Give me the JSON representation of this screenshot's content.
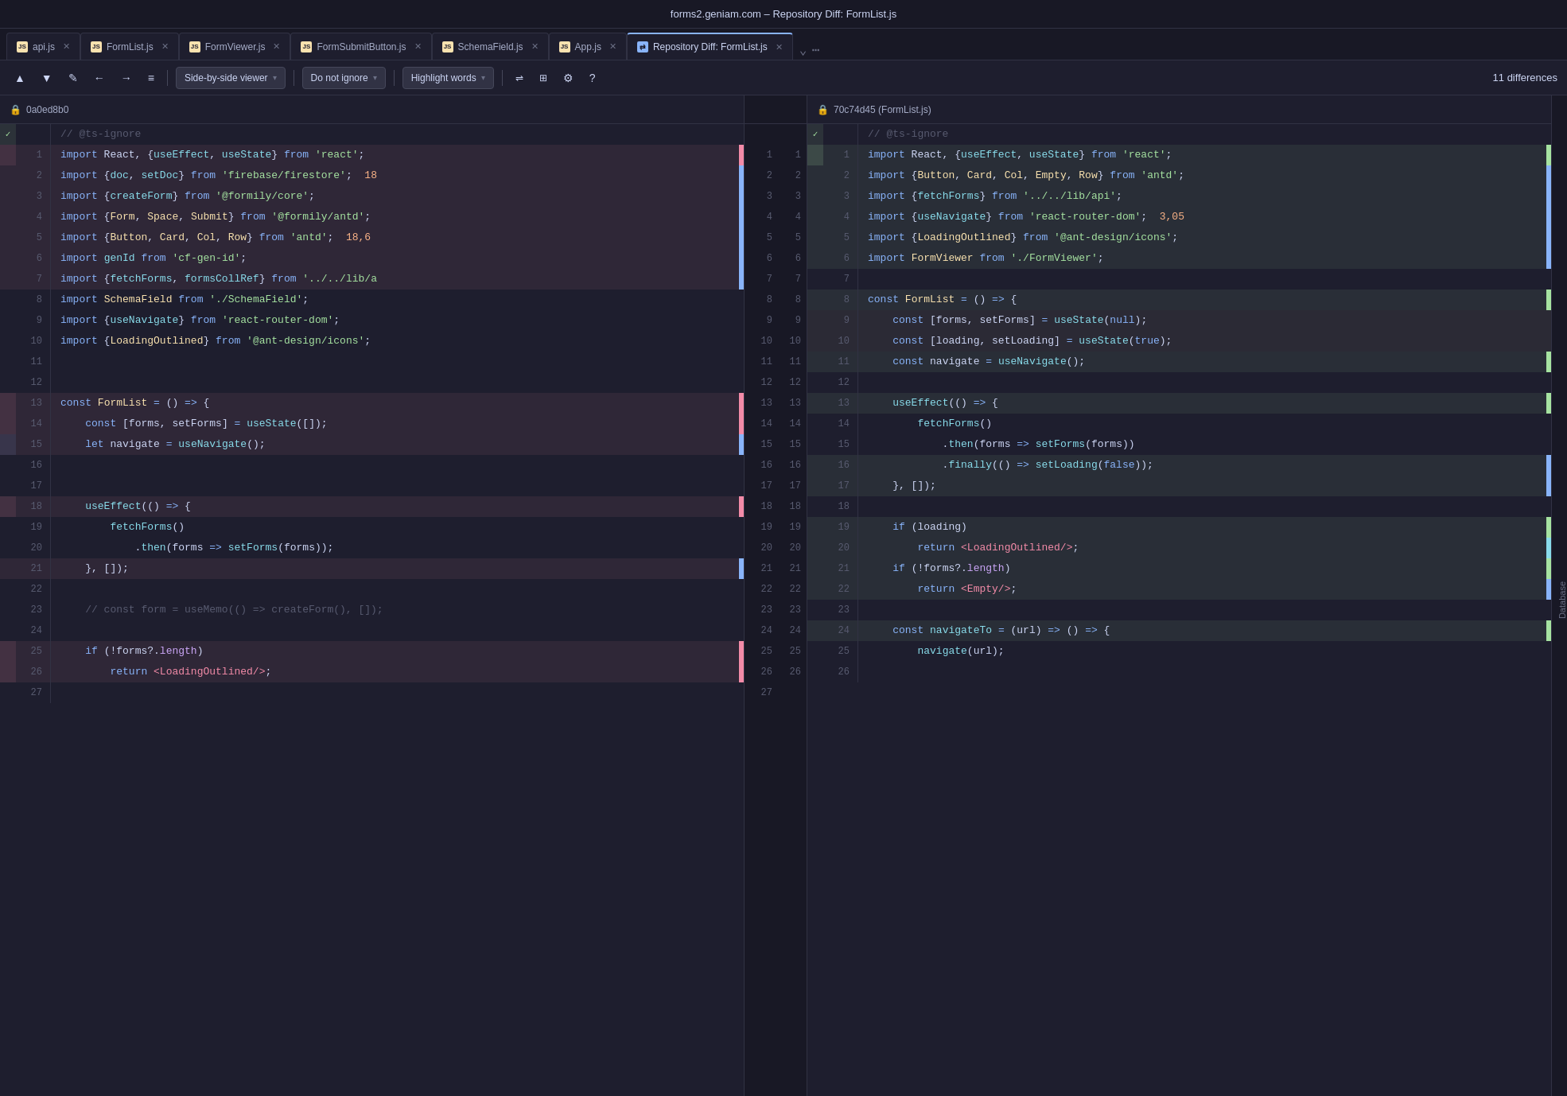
{
  "titleBar": {
    "title": "forms2.geniam.com – Repository Diff: FormList.js"
  },
  "tabs": [
    {
      "id": "api",
      "label": "api.js",
      "iconType": "js",
      "active": false
    },
    {
      "id": "formlist",
      "label": "FormList.js",
      "iconType": "js",
      "active": false
    },
    {
      "id": "formviewer",
      "label": "FormViewer.js",
      "iconType": "js",
      "active": false
    },
    {
      "id": "formsubmit",
      "label": "FormSubmitButton.js",
      "iconType": "js",
      "active": false
    },
    {
      "id": "schemafield",
      "label": "SchemaField.js",
      "iconType": "js",
      "active": false
    },
    {
      "id": "appjs",
      "label": "App.js",
      "iconType": "js",
      "active": false
    },
    {
      "id": "repodiff",
      "label": "Repository Diff: FormList.js",
      "iconType": "diff",
      "active": true
    }
  ],
  "toolbar": {
    "upBtn": "▲",
    "downBtn": "▼",
    "editBtn": "✎",
    "backBtn": "←",
    "fwdBtn": "→",
    "listBtn": "≡",
    "viewerLabel": "Side-by-side viewer",
    "ignoreLabel": "Do not ignore",
    "highlightLabel": "Highlight words",
    "settingsBtn": "⚙",
    "helpBtn": "?",
    "diffCount": "11 differences"
  },
  "leftPane": {
    "hash": "0a0ed8b0"
  },
  "rightPane": {
    "hash": "70c74d45 (FormList.js)"
  },
  "leftLines": [
    {
      "lineNum": "",
      "marker": "✓",
      "markerClass": "marker-added",
      "bg": "",
      "content": "// @ts-ignore",
      "contentClass": "cm"
    },
    {
      "lineNum": "1",
      "marker": "",
      "markerClass": "",
      "bg": "bg-removed",
      "ind": "ind-red",
      "content": "import React, {useEffect, useState} from 'react';"
    },
    {
      "lineNum": "2",
      "marker": "",
      "markerClass": "",
      "bg": "bg-removed",
      "ind": "ind-blue",
      "content": "import {doc, setDoc} from 'firebase/firestore';  18"
    },
    {
      "lineNum": "3",
      "marker": "",
      "markerClass": "",
      "bg": "bg-removed",
      "ind": "ind-blue",
      "content": "import {createForm} from '@formily/core';"
    },
    {
      "lineNum": "4",
      "marker": "",
      "markerClass": "",
      "bg": "bg-removed",
      "ind": "ind-blue",
      "content": "import {Form, Space, Submit} from '@formily/antd';"
    },
    {
      "lineNum": "5",
      "marker": "",
      "markerClass": "",
      "bg": "bg-removed",
      "ind": "ind-blue",
      "content": "import {Button, Card, Col, Row} from 'antd';  18,6"
    },
    {
      "lineNum": "6",
      "marker": "",
      "markerClass": "",
      "bg": "bg-removed",
      "ind": "ind-blue",
      "content": "import genId from 'cf-gen-id';"
    },
    {
      "lineNum": "7",
      "marker": "",
      "markerClass": "",
      "bg": "bg-removed",
      "ind": "ind-blue",
      "content": "import {fetchForms, formsCollRef} from '../../lib/a"
    },
    {
      "lineNum": "8",
      "marker": "",
      "markerClass": "",
      "bg": "",
      "content": "import SchemaField from './SchemaField';"
    },
    {
      "lineNum": "9",
      "marker": "",
      "markerClass": "",
      "bg": "",
      "content": "import {useNavigate} from 'react-router-dom';"
    },
    {
      "lineNum": "10",
      "marker": "",
      "markerClass": "",
      "bg": "",
      "content": "import {LoadingOutlined} from '@ant-design/icons';"
    },
    {
      "lineNum": "11",
      "marker": "",
      "markerClass": "",
      "bg": "",
      "content": ""
    },
    {
      "lineNum": "12",
      "marker": "",
      "markerClass": "",
      "bg": "",
      "content": ""
    },
    {
      "lineNum": "13",
      "marker": "",
      "markerClass": "",
      "bg": "bg-removed",
      "ind": "ind-red",
      "content": "const FormList = () => {"
    },
    {
      "lineNum": "14",
      "marker": "",
      "markerClass": "",
      "bg": "bg-removed",
      "ind": "ind-red",
      "content": "    const [forms, setForms] = useState([]);"
    },
    {
      "lineNum": "15",
      "marker": "",
      "markerClass": "",
      "bg": "bg-removed",
      "ind": "ind-red",
      "content": "    let navigate = useNavigate();"
    },
    {
      "lineNum": "16",
      "marker": "",
      "markerClass": "",
      "bg": "",
      "content": ""
    },
    {
      "lineNum": "17",
      "marker": "",
      "markerClass": "",
      "bg": "",
      "content": ""
    },
    {
      "lineNum": "18",
      "marker": "",
      "markerClass": "",
      "bg": "bg-removed",
      "ind": "ind-red",
      "content": "    useEffect(() => {"
    },
    {
      "lineNum": "19",
      "marker": "",
      "markerClass": "",
      "bg": "",
      "content": "        fetchForms()"
    },
    {
      "lineNum": "20",
      "marker": "",
      "markerClass": "",
      "bg": "",
      "content": "            .then(forms => setForms(forms));"
    },
    {
      "lineNum": "21",
      "marker": "",
      "markerClass": "",
      "bg": "bg-removed",
      "ind": "ind-blue",
      "content": "    }, []);"
    },
    {
      "lineNum": "22",
      "marker": "",
      "markerClass": "",
      "bg": "",
      "content": ""
    },
    {
      "lineNum": "23",
      "marker": "",
      "markerClass": "",
      "bg": "",
      "content": "    // const form = useMemo(() => createForm(), []);"
    },
    {
      "lineNum": "24",
      "marker": "",
      "markerClass": "",
      "bg": "",
      "content": ""
    },
    {
      "lineNum": "25",
      "marker": "",
      "markerClass": "",
      "bg": "bg-removed",
      "ind": "ind-red",
      "content": "    if (!forms?.length)"
    },
    {
      "lineNum": "26",
      "marker": "",
      "markerClass": "",
      "bg": "bg-removed",
      "ind": "ind-red",
      "content": "        return <LoadingOutlined/>;"
    },
    {
      "lineNum": "27",
      "marker": "",
      "markerClass": "",
      "bg": "",
      "content": ""
    }
  ],
  "rightLines": [
    {
      "lineNum": "",
      "marker": "✓",
      "markerClass": "marker-added",
      "bg": "",
      "content": "// @ts-ignore",
      "contentClass": "cm"
    },
    {
      "lineNum": "1",
      "marker": "",
      "markerClass": "",
      "bg": "bg-added",
      "ind": "ind-green",
      "content": "import React, {useEffect, useState} from 'react';"
    },
    {
      "lineNum": "2",
      "marker": "",
      "markerClass": "",
      "bg": "bg-added",
      "ind": "ind-blue",
      "content": "import {Button, Card, Col, Empty, Row} from 'antd';"
    },
    {
      "lineNum": "3",
      "marker": "",
      "markerClass": "",
      "bg": "bg-added",
      "ind": "ind-blue",
      "content": "import {fetchForms} from '../../lib/api';"
    },
    {
      "lineNum": "4",
      "marker": "",
      "markerClass": "",
      "bg": "bg-added",
      "ind": "ind-blue",
      "content": "import {useNavigate} from 'react-router-dom';  3,05"
    },
    {
      "lineNum": "5",
      "marker": "",
      "markerClass": "",
      "bg": "bg-added",
      "ind": "ind-blue",
      "content": "import {LoadingOutlined} from '@ant-design/icons';"
    },
    {
      "lineNum": "6",
      "marker": "",
      "markerClass": "",
      "bg": "bg-added",
      "ind": "ind-blue",
      "content": "import FormViewer from './FormViewer';"
    },
    {
      "lineNum": "7",
      "marker": "",
      "markerClass": "",
      "bg": "",
      "content": ""
    },
    {
      "lineNum": "8",
      "marker": "",
      "markerClass": "",
      "bg": "bg-added",
      "ind": "ind-green",
      "content": "const FormList = () => {"
    },
    {
      "lineNum": "9",
      "marker": "",
      "markerClass": "",
      "bg": "bg-changed",
      "content": "    const [forms, setForms] = useState(null);"
    },
    {
      "lineNum": "10",
      "marker": "",
      "markerClass": "",
      "bg": "bg-changed",
      "content": "    const [loading, setLoading] = useState(true);"
    },
    {
      "lineNum": "11",
      "marker": "",
      "markerClass": "",
      "bg": "bg-added",
      "ind": "ind-green",
      "content": "    const navigate = useNavigate();"
    },
    {
      "lineNum": "12",
      "marker": "",
      "markerClass": "",
      "bg": "",
      "content": ""
    },
    {
      "lineNum": "13",
      "marker": "",
      "markerClass": "",
      "bg": "bg-added",
      "ind": "ind-green",
      "content": "    useEffect(() => {"
    },
    {
      "lineNum": "14",
      "marker": "",
      "markerClass": "",
      "bg": "",
      "content": "        fetchForms()"
    },
    {
      "lineNum": "15",
      "marker": "",
      "markerClass": "",
      "bg": "",
      "content": "            .then(forms => setForms(forms))"
    },
    {
      "lineNum": "16",
      "marker": "",
      "markerClass": "",
      "bg": "bg-added",
      "ind": "ind-blue",
      "content": "            .finally(() => setLoading(false));"
    },
    {
      "lineNum": "17",
      "marker": "",
      "markerClass": "",
      "bg": "bg-added",
      "ind": "ind-blue",
      "content": "    }, []);"
    },
    {
      "lineNum": "18",
      "marker": "",
      "markerClass": "",
      "bg": "",
      "content": ""
    },
    {
      "lineNum": "19",
      "marker": "",
      "markerClass": "",
      "bg": "bg-added",
      "ind": "ind-green",
      "content": "    if (loading)"
    },
    {
      "lineNum": "20",
      "marker": "",
      "markerClass": "",
      "bg": "bg-added",
      "ind": "ind-blue",
      "content": "        return <LoadingOutlined/>;"
    },
    {
      "lineNum": "21",
      "marker": "",
      "markerClass": "",
      "bg": "bg-added",
      "ind": "ind-green",
      "content": "    if (!forms?.length)"
    },
    {
      "lineNum": "22",
      "marker": "",
      "markerClass": "",
      "bg": "bg-added",
      "ind": "ind-blue",
      "content": "        return <Empty/>;"
    },
    {
      "lineNum": "23",
      "marker": "",
      "markerClass": "",
      "bg": "",
      "content": ""
    },
    {
      "lineNum": "24",
      "marker": "",
      "markerClass": "",
      "bg": "bg-added",
      "ind": "ind-green",
      "content": "    const navigateTo = (url) => () => {"
    },
    {
      "lineNum": "25",
      "marker": "",
      "markerClass": "",
      "bg": "",
      "content": "        navigate(url);"
    },
    {
      "lineNum": "26",
      "marker": "",
      "markerClass": "",
      "bg": "",
      "content": ""
    }
  ],
  "centerLineNums": [
    [
      "",
      ""
    ],
    [
      "1",
      "1"
    ],
    [
      "2",
      "2"
    ],
    [
      "3",
      "3"
    ],
    [
      "4",
      "4"
    ],
    [
      "5",
      "5"
    ],
    [
      "6",
      "6"
    ],
    [
      "7",
      "7"
    ],
    [
      "8",
      "8"
    ],
    [
      "9",
      "9"
    ],
    [
      "10",
      "10"
    ],
    [
      "11",
      "11"
    ],
    [
      "12",
      "12"
    ],
    [
      "13",
      "13"
    ],
    [
      "14",
      "14"
    ],
    [
      "15",
      "15"
    ],
    [
      "16",
      "16"
    ],
    [
      "17",
      "17"
    ],
    [
      "18",
      "18"
    ],
    [
      "19",
      "19"
    ],
    [
      "20",
      "20"
    ],
    [
      "21",
      "21"
    ],
    [
      "22",
      "22"
    ],
    [
      "23",
      "23"
    ],
    [
      "24",
      "24"
    ],
    [
      "25",
      "25"
    ],
    [
      "26",
      "26"
    ],
    [
      "27",
      ""
    ]
  ],
  "rightSidebar": {
    "label": "Database"
  }
}
